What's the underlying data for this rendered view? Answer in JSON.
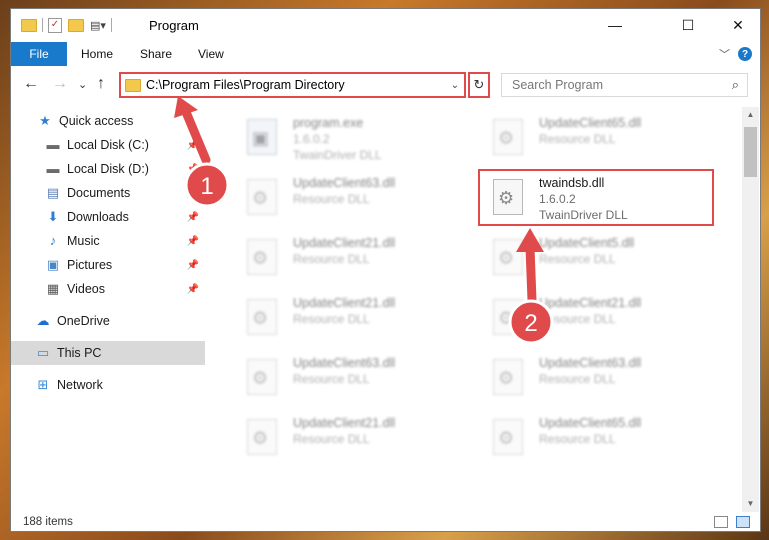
{
  "window": {
    "title": "Program",
    "controls": {
      "minimize": "—",
      "maximize": "☐",
      "close": "✕"
    }
  },
  "ribbon": {
    "tabs": [
      "File",
      "Home",
      "Share",
      "View"
    ],
    "expand_icon": "chevron-down-icon",
    "help_icon": "?"
  },
  "navigation": {
    "back": "←",
    "forward": "→",
    "recent": "⌄",
    "up": "↑",
    "address": "C:\\Program Files\\Program Directory",
    "refresh": "↻",
    "search_placeholder": "Search Program",
    "search_icon": "⌕"
  },
  "sidebar": {
    "items": [
      {
        "label": "Quick access",
        "icon": "star-icon",
        "glyph": "★",
        "color": "#2f7fd6",
        "pinned": false
      },
      {
        "label": "Local Disk (C:)",
        "icon": "drive-icon",
        "glyph": "▬",
        "color": "#6b6b6b",
        "pinned": true
      },
      {
        "label": "Local Disk (D:)",
        "icon": "drive-icon",
        "glyph": "▬",
        "color": "#6b6b6b",
        "pinned": true
      },
      {
        "label": "Documents",
        "icon": "documents-icon",
        "glyph": "▤",
        "color": "#5a7fb5",
        "pinned": true
      },
      {
        "label": "Downloads",
        "icon": "downloads-icon",
        "glyph": "⬇",
        "color": "#2f7fd6",
        "pinned": true
      },
      {
        "label": "Music",
        "icon": "music-icon",
        "glyph": "♪",
        "color": "#2f7fd6",
        "pinned": true
      },
      {
        "label": "Pictures",
        "icon": "pictures-icon",
        "glyph": "▣",
        "color": "#4a86c5",
        "pinned": true
      },
      {
        "label": "Videos",
        "icon": "videos-icon",
        "glyph": "▦",
        "color": "#555555",
        "pinned": true
      },
      {
        "label": "OneDrive",
        "icon": "onedrive-icon",
        "glyph": "☁",
        "color": "#1e6fd0",
        "pinned": false
      },
      {
        "label": "This PC",
        "icon": "computer-icon",
        "glyph": "▭",
        "color": "#3a8ad8",
        "pinned": false,
        "selected": true
      },
      {
        "label": "Network",
        "icon": "network-icon",
        "glyph": "⊞",
        "color": "#3a8ad8",
        "pinned": false
      }
    ]
  },
  "files": [
    {
      "name": "program.exe",
      "line2": "1.6.0.2",
      "line3": "TwainDriver DLL",
      "icon": "exe-icon",
      "blurred": true
    },
    {
      "name": "UpdateClient65.dll",
      "line2": "Resource DLL",
      "line3": "",
      "icon": "dll-icon",
      "blurred": true
    },
    {
      "name": "UpdateClient63.dll",
      "line2": "Resource DLL",
      "line3": "",
      "icon": "dll-icon",
      "blurred": true
    },
    {
      "name": "twaindsb.dll",
      "line2": "1.6.0.2",
      "line3": "TwainDriver DLL",
      "icon": "dll-icon",
      "blurred": false
    },
    {
      "name": "UpdateClient21.dll",
      "line2": "Resource DLL",
      "line3": "",
      "icon": "dll-icon",
      "blurred": true
    },
    {
      "name": "UpdateClient5.dll",
      "line2": "Resource DLL",
      "line3": "",
      "icon": "dll-icon",
      "blurred": true
    },
    {
      "name": "UpdateClient21.dll",
      "line2": "Resource DLL",
      "line3": "",
      "icon": "dll-icon",
      "blurred": true
    },
    {
      "name": "UpdateClient21.dll",
      "line2": "Resource DLL",
      "line3": "",
      "icon": "dll-icon",
      "blurred": true
    },
    {
      "name": "UpdateClient63.dll",
      "line2": "Resource DLL",
      "line3": "",
      "icon": "dll-icon",
      "blurred": true
    },
    {
      "name": "UpdateClient63.dll",
      "line2": "Resource DLL",
      "line3": "",
      "icon": "dll-icon",
      "blurred": true
    },
    {
      "name": "UpdateClient21.dll",
      "line2": "Resource DLL",
      "line3": "",
      "icon": "dll-icon",
      "blurred": true
    },
    {
      "name": "UpdateClient65.dll",
      "line2": "Resource DLL",
      "line3": "",
      "icon": "dll-icon",
      "blurred": true
    }
  ],
  "statusbar": {
    "item_count": "188 items"
  },
  "annotations": {
    "step1": "1",
    "step2": "2",
    "accent_color": "#e14a4a"
  }
}
